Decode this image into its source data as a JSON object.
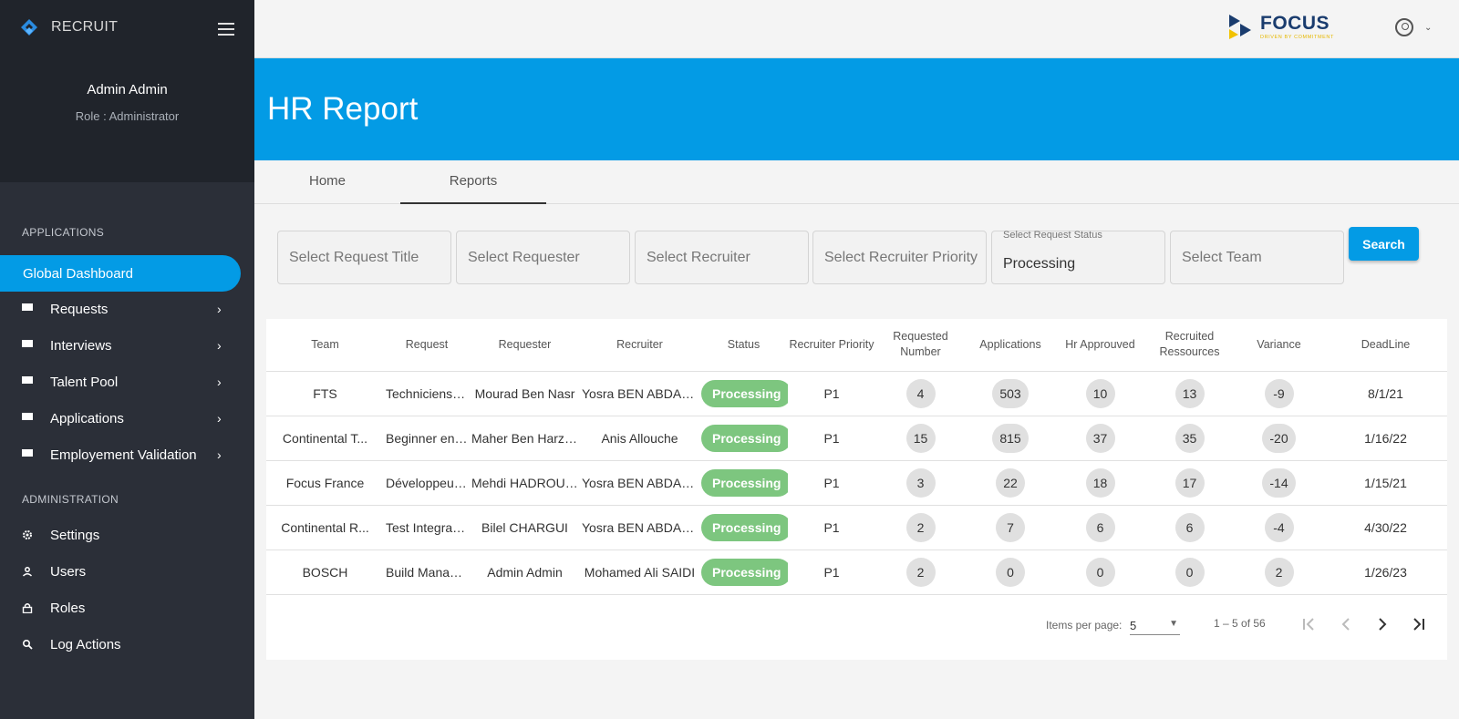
{
  "app": {
    "name": "RECRUIT",
    "user_name": "Admin Admin",
    "user_role": "Role : Administrator"
  },
  "sidebar": {
    "section_applications": "APPLICATIONS",
    "section_administration": "ADMINISTRATION",
    "items": [
      {
        "label": "Global Dashboard",
        "icon": "none",
        "active": true
      },
      {
        "label": "Requests",
        "icon": "grid-icon"
      },
      {
        "label": "Interviews",
        "icon": "grid-icon"
      },
      {
        "label": "Talent Pool",
        "icon": "grid-icon"
      },
      {
        "label": "Applications",
        "icon": "grid-icon"
      },
      {
        "label": "Employement Validation",
        "icon": "grid-icon"
      }
    ],
    "admin_items": [
      {
        "label": "Settings",
        "icon": "gear-icon"
      },
      {
        "label": "Users",
        "icon": "user-icon"
      },
      {
        "label": "Roles",
        "icon": "lock-icon"
      },
      {
        "label": "Log Actions",
        "icon": "search-icon"
      }
    ]
  },
  "header": {
    "logo_word": "FOCUS",
    "logo_tagline": "DRIVEN BY COMMITMENT"
  },
  "page": {
    "title": "HR Report"
  },
  "tabs": [
    {
      "label": "Home",
      "active": false
    },
    {
      "label": "Reports",
      "active": true
    }
  ],
  "filters": {
    "request_title": "Select Request Title",
    "requester": "Select Requester",
    "recruiter": "Select Recruiter",
    "recruiter_priority": "Select Recruiter Priority",
    "status_label": "Select Request Status",
    "status_value": "Processing",
    "team": "Select Team",
    "search_label": "Search"
  },
  "table": {
    "headers": [
      "Team",
      "Request",
      "Requester",
      "Recruiter",
      "Status",
      "Recruiter Priority",
      "Requested Number",
      "Applications",
      "Hr Approuved",
      "Recruited Ressources",
      "Variance",
      "DeadLine"
    ],
    "rows": [
      {
        "team": "FTS",
        "request": "Techniciens s...",
        "requester": "Mourad Ben Nasr",
        "recruiter": "Yosra BEN ABDAL...",
        "status": "Processing",
        "priority": "P1",
        "requested": "4",
        "applications": "503",
        "hr_approved": "10",
        "recruited": "13",
        "variance": "-9",
        "deadline": "8/1/21"
      },
      {
        "team": "Continental T...",
        "request": "Beginner engi...",
        "requester": "Maher Ben Harzall...",
        "recruiter": "Anis Allouche",
        "status": "Processing",
        "priority": "P1",
        "requested": "15",
        "applications": "815",
        "hr_approved": "37",
        "recruited": "35",
        "variance": "-20",
        "deadline": "1/16/22"
      },
      {
        "team": "Focus France",
        "request": "Développeurs...",
        "requester": "Mehdi HADROUCHI",
        "recruiter": "Yosra BEN ABDAL...",
        "status": "Processing",
        "priority": "P1",
        "requested": "3",
        "applications": "22",
        "hr_approved": "18",
        "recruited": "17",
        "variance": "-14",
        "deadline": "1/15/21"
      },
      {
        "team": "Continental R...",
        "request": "Test Integrati...",
        "requester": "Bilel CHARGUI",
        "recruiter": "Yosra BEN ABDAL...",
        "status": "Processing",
        "priority": "P1",
        "requested": "2",
        "applications": "7",
        "hr_approved": "6",
        "recruited": "6",
        "variance": "-4",
        "deadline": "4/30/22"
      },
      {
        "team": "BOSCH",
        "request": "Build Manager",
        "requester": "Admin Admin",
        "recruiter": "Mohamed Ali SAIDI",
        "status": "Processing",
        "priority": "P1",
        "requested": "2",
        "applications": "0",
        "hr_approved": "0",
        "recruited": "0",
        "variance": "2",
        "deadline": "1/26/23"
      }
    ]
  },
  "paginator": {
    "items_per_page_label": "Items per page:",
    "items_per_page": "5",
    "range": "1 – 5 of 56"
  },
  "colors": {
    "primary": "#039be5",
    "sidebar": "#2b2f38",
    "status_processing": "#7dc67f"
  }
}
